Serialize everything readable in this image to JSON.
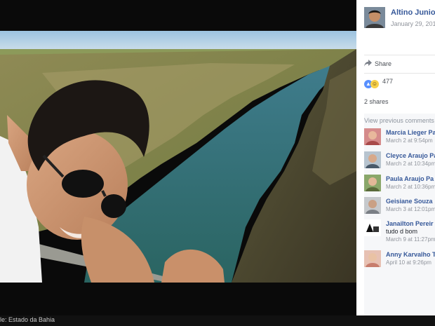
{
  "photo": {
    "caption": "le: Estado da Bahia",
    "alt": "selfie-over-river-canyon"
  },
  "post": {
    "author": "Altino Junio",
    "date": "January 29, 201",
    "share_label": "Share",
    "reaction_count": "477",
    "shares_label": "2 shares",
    "view_previous": "View previous comments"
  },
  "comments": [
    {
      "name": "Marcia Lieger Pa",
      "text": "",
      "time": "March 2 at 9:54pm"
    },
    {
      "name": "Cleyce Araujo Pa",
      "text": "",
      "time": "March 2 at 10:34pm"
    },
    {
      "name": "Paula Araujo Pa",
      "text": "",
      "time": "March 2 at 10:36pm"
    },
    {
      "name": "Geisiane Souza",
      "text": "",
      "time": "March 3 at 12:01pm"
    },
    {
      "name": "Janailton Pereir",
      "text": "tudo d bom",
      "time": "March 9 at 11:27pm"
    },
    {
      "name": "Anny Karvalho T",
      "text": "",
      "time": "April 10 at 9:26pm"
    }
  ],
  "colors": {
    "link": "#365899",
    "like": "#5890ff",
    "haha": "#f7d04a",
    "river": "#2f6b6b"
  }
}
